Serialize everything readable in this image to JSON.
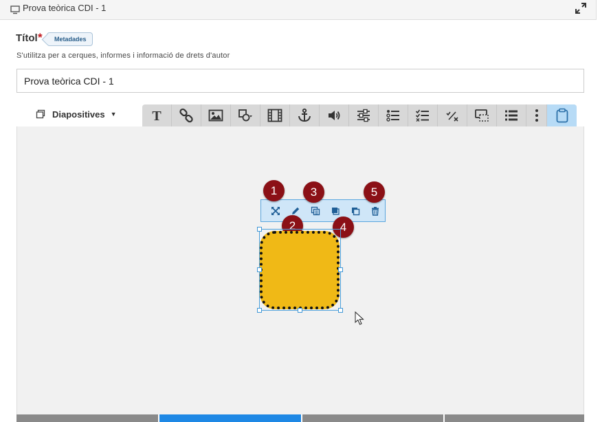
{
  "window": {
    "title": "Prova teòrica CDI - 1",
    "icons": {
      "window": "monitor-icon",
      "expand": "expand-icon"
    }
  },
  "form": {
    "title_label": "Títol",
    "required_mark": "*",
    "metadata_badge": "Metadades",
    "help_text": "S'utilitza per a cerques, informes i informació de drets d'autor",
    "title_value": "Prova teòrica CDI - 1"
  },
  "editor": {
    "slides_label": "Diapositives",
    "toolbar": [
      {
        "name": "text-tool",
        "icon": "text-icon"
      },
      {
        "name": "link-tool",
        "icon": "link-icon"
      },
      {
        "name": "image-tool",
        "icon": "image-icon"
      },
      {
        "name": "shapes-tool",
        "icon": "shapes-icon"
      },
      {
        "name": "video-tool",
        "icon": "film-icon"
      },
      {
        "name": "anchor-tool",
        "icon": "anchor-icon"
      },
      {
        "name": "audio-tool",
        "icon": "speaker-icon"
      },
      {
        "name": "interaction-tool",
        "icon": "sliders-icon"
      },
      {
        "name": "single-choice-tool",
        "icon": "list-radio-icon"
      },
      {
        "name": "multi-choice-tool",
        "icon": "list-check-icon"
      },
      {
        "name": "true-false-tool",
        "icon": "check-cross-icon"
      },
      {
        "name": "hotspot-tool",
        "icon": "hotspot-icon"
      },
      {
        "name": "list-tool",
        "icon": "list-icon"
      },
      {
        "name": "more-tool",
        "icon": "more-icon"
      },
      {
        "name": "clipboard-tool",
        "icon": "clipboard-icon"
      }
    ],
    "element_bar": [
      {
        "name": "fullscreen-button",
        "icon": "resize-icon"
      },
      {
        "name": "edit-button",
        "icon": "pencil-icon"
      },
      {
        "name": "copy-button",
        "icon": "copy-icon"
      },
      {
        "name": "bring-front-button",
        "icon": "bring-front-icon"
      },
      {
        "name": "send-back-button",
        "icon": "send-back-icon"
      },
      {
        "name": "delete-button",
        "icon": "trash-icon"
      }
    ],
    "markers": [
      "1",
      "2",
      "3",
      "4",
      "5"
    ]
  },
  "colors": {
    "shape_fill": "#f0b916",
    "marker": "#8b1016",
    "selection": "#4aa0dc",
    "toolbar_active": "#b7dbf6"
  }
}
